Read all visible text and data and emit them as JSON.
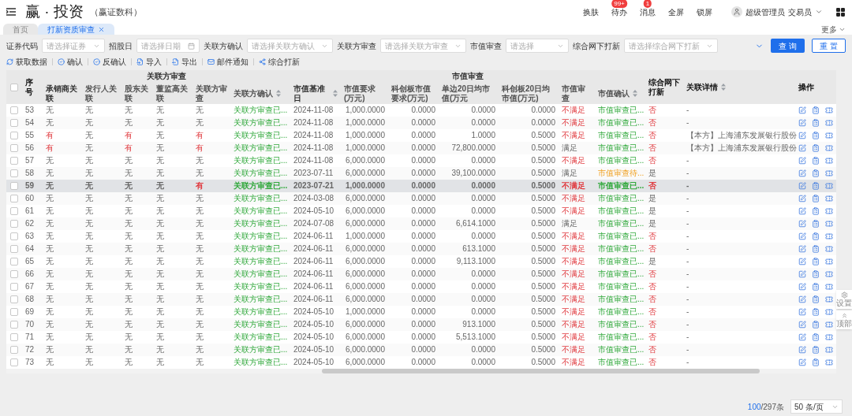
{
  "header": {
    "logo": "赢 · 投资",
    "subtitle": "（赢证数科）",
    "actions": [
      {
        "label": "换肤"
      },
      {
        "label": "待办",
        "badge": "99+"
      },
      {
        "label": "消息",
        "badge": "1"
      },
      {
        "label": "全屏"
      },
      {
        "label": "锁屏"
      }
    ],
    "user": "超级管理员",
    "role": "交易员"
  },
  "tabs": [
    {
      "label": "首页",
      "selected": false,
      "closable": false
    },
    {
      "label": "打新资质审查",
      "selected": true,
      "closable": true
    }
  ],
  "more": "更多",
  "filters": [
    {
      "label": "证券代码",
      "placeholder": "请选择证券",
      "kind": "select"
    },
    {
      "label": "招股日",
      "placeholder": "请选择日期",
      "kind": "date"
    },
    {
      "label": "关联方确认",
      "placeholder": "请选择关联方确认",
      "kind": "select"
    },
    {
      "label": "关联方审查",
      "placeholder": "请选择关联方审查",
      "kind": "select"
    },
    {
      "label": "市值审查",
      "placeholder": "请选择",
      "kind": "select"
    },
    {
      "label": "综合网下打新",
      "placeholder": "请选择综合网下打新",
      "kind": "select"
    }
  ],
  "filter_buttons": [
    {
      "label": "查 询",
      "kind": "primary"
    },
    {
      "label": "重 置",
      "kind": "outline"
    }
  ],
  "toolbar": [
    {
      "label": "获取数据"
    },
    {
      "label": "确认"
    },
    {
      "label": "反确认"
    },
    {
      "label": "导入"
    },
    {
      "label": "导出"
    },
    {
      "label": "邮件通知"
    },
    {
      "label": "综合打新"
    }
  ],
  "table": {
    "select_all": {
      "checked": false
    },
    "column_groups": [
      "关联方审查",
      "市值审查"
    ],
    "columns": [
      {
        "label": "序号",
        "grouped": false
      },
      {
        "label": "承销商关联",
        "grouped": true,
        "group_start": true
      },
      {
        "label": "发行人关联",
        "grouped": true
      },
      {
        "label": "股东关联",
        "grouped": true
      },
      {
        "label": "董监高关联",
        "grouped": true
      },
      {
        "label": "关联方审查",
        "grouped": true
      },
      {
        "label": "关联方确认",
        "grouped": true,
        "sortable": true
      },
      {
        "label": "市值基准日",
        "grouped": true,
        "group_start": true,
        "sortable": true
      },
      {
        "label": "市值要求(万元)",
        "grouped": true
      },
      {
        "label": "科创板市值要求(万元)",
        "grouped": true
      },
      {
        "label": "单边20日均市值(万元",
        "grouped": true
      },
      {
        "label": "科创板20日均市值(万元)",
        "grouped": true
      },
      {
        "label": "市值审查",
        "grouped": true
      },
      {
        "label": "市值确认",
        "grouped": true,
        "sortable": true
      },
      {
        "label": "综合网下打新",
        "grouped": false
      },
      {
        "label": "关联详情",
        "grouped": false,
        "sortable": true
      },
      {
        "label": "操作",
        "grouped": false,
        "kind": "actions"
      }
    ],
    "rows": [
      {
        "checked": false,
        "selected": false,
        "cells": [
          {
            "text": "53",
            "kind": "plain"
          },
          {
            "text": "无",
            "kind": "plain"
          },
          {
            "text": "无",
            "kind": "plain"
          },
          {
            "text": "无",
            "kind": "plain"
          },
          {
            "text": "无",
            "kind": "plain"
          },
          {
            "text": "无",
            "kind": "plain"
          },
          {
            "text": "关联方审查已...",
            "kind": "done"
          },
          {
            "text": "2024-11-08",
            "kind": "plain"
          },
          {
            "text": "1,000.0000",
            "kind": "plain"
          },
          {
            "text": "0.0000",
            "kind": "plain"
          },
          {
            "text": "0.0000",
            "kind": "plain"
          },
          {
            "text": "0.0000",
            "kind": "plain"
          },
          {
            "text": "不满足",
            "kind": "alert"
          },
          {
            "text": "市值审查已...",
            "kind": "done"
          },
          {
            "text": "否",
            "kind": "alert"
          },
          {
            "text": "-",
            "kind": "plain"
          }
        ]
      },
      {
        "checked": false,
        "selected": false,
        "cells": [
          {
            "text": "54",
            "kind": "plain"
          },
          {
            "text": "无",
            "kind": "plain"
          },
          {
            "text": "无",
            "kind": "plain"
          },
          {
            "text": "无",
            "kind": "plain"
          },
          {
            "text": "无",
            "kind": "plain"
          },
          {
            "text": "无",
            "kind": "plain"
          },
          {
            "text": "关联方审查已...",
            "kind": "done"
          },
          {
            "text": "2024-11-08",
            "kind": "plain"
          },
          {
            "text": "1,000.0000",
            "kind": "plain"
          },
          {
            "text": "0.0000",
            "kind": "plain"
          },
          {
            "text": "0.0000",
            "kind": "plain"
          },
          {
            "text": "0.0000",
            "kind": "plain"
          },
          {
            "text": "不满足",
            "kind": "alert"
          },
          {
            "text": "市值审查已...",
            "kind": "done"
          },
          {
            "text": "否",
            "kind": "alert"
          },
          {
            "text": "-",
            "kind": "plain"
          }
        ]
      },
      {
        "checked": false,
        "selected": false,
        "cells": [
          {
            "text": "55",
            "kind": "plain"
          },
          {
            "text": "有",
            "kind": "alert"
          },
          {
            "text": "无",
            "kind": "plain"
          },
          {
            "text": "有",
            "kind": "alert"
          },
          {
            "text": "无",
            "kind": "plain"
          },
          {
            "text": "有",
            "kind": "alert"
          },
          {
            "text": "关联方审查已...",
            "kind": "done"
          },
          {
            "text": "2024-11-08",
            "kind": "plain"
          },
          {
            "text": "1,000.0000",
            "kind": "plain"
          },
          {
            "text": "0.0000",
            "kind": "plain"
          },
          {
            "text": "1.0000",
            "kind": "plain"
          },
          {
            "text": "0.5000",
            "kind": "plain"
          },
          {
            "text": "不满足",
            "kind": "alert"
          },
          {
            "text": "市值审查已...",
            "kind": "done"
          },
          {
            "text": "否",
            "kind": "alert"
          },
          {
            "text": "【本方】上海浦东发展银行股份",
            "kind": "plain"
          }
        ]
      },
      {
        "checked": false,
        "selected": false,
        "cells": [
          {
            "text": "56",
            "kind": "plain"
          },
          {
            "text": "有",
            "kind": "alert"
          },
          {
            "text": "无",
            "kind": "plain"
          },
          {
            "text": "有",
            "kind": "alert"
          },
          {
            "text": "无",
            "kind": "plain"
          },
          {
            "text": "有",
            "kind": "alert"
          },
          {
            "text": "关联方审查已...",
            "kind": "done"
          },
          {
            "text": "2024-11-08",
            "kind": "plain"
          },
          {
            "text": "1,000.0000",
            "kind": "plain"
          },
          {
            "text": "0.0000",
            "kind": "plain"
          },
          {
            "text": "72,800.0000",
            "kind": "plain"
          },
          {
            "text": "0.5000",
            "kind": "plain"
          },
          {
            "text": "满足",
            "kind": "plain"
          },
          {
            "text": "市值审查已...",
            "kind": "done"
          },
          {
            "text": "否",
            "kind": "alert"
          },
          {
            "text": "【本方】上海浦东发展银行股份",
            "kind": "plain"
          }
        ]
      },
      {
        "checked": false,
        "selected": false,
        "cells": [
          {
            "text": "57",
            "kind": "plain"
          },
          {
            "text": "无",
            "kind": "plain"
          },
          {
            "text": "无",
            "kind": "plain"
          },
          {
            "text": "无",
            "kind": "plain"
          },
          {
            "text": "无",
            "kind": "plain"
          },
          {
            "text": "无",
            "kind": "plain"
          },
          {
            "text": "关联方审查已...",
            "kind": "done"
          },
          {
            "text": "2024-11-08",
            "kind": "plain"
          },
          {
            "text": "6,000.0000",
            "kind": "plain"
          },
          {
            "text": "0.0000",
            "kind": "plain"
          },
          {
            "text": "0.0000",
            "kind": "plain"
          },
          {
            "text": "0.5000",
            "kind": "plain"
          },
          {
            "text": "不满足",
            "kind": "alert"
          },
          {
            "text": "市值审查已...",
            "kind": "done"
          },
          {
            "text": "否",
            "kind": "alert"
          },
          {
            "text": "-",
            "kind": "plain"
          }
        ]
      },
      {
        "checked": false,
        "selected": false,
        "cells": [
          {
            "text": "58",
            "kind": "plain"
          },
          {
            "text": "无",
            "kind": "plain"
          },
          {
            "text": "无",
            "kind": "plain"
          },
          {
            "text": "无",
            "kind": "plain"
          },
          {
            "text": "无",
            "kind": "plain"
          },
          {
            "text": "无",
            "kind": "plain"
          },
          {
            "text": "关联方审查已...",
            "kind": "done"
          },
          {
            "text": "2023-07-11",
            "kind": "plain"
          },
          {
            "text": "6,000.0000",
            "kind": "plain"
          },
          {
            "text": "0.0000",
            "kind": "plain"
          },
          {
            "text": "39,100.0000",
            "kind": "plain"
          },
          {
            "text": "0.5000",
            "kind": "plain"
          },
          {
            "text": "满足",
            "kind": "plain"
          },
          {
            "text": "市值审查待...",
            "kind": "pending"
          },
          {
            "text": "是",
            "kind": "plain"
          },
          {
            "text": "-",
            "kind": "plain"
          }
        ]
      },
      {
        "checked": false,
        "selected": true,
        "cells": [
          {
            "text": "59",
            "kind": "plain"
          },
          {
            "text": "无",
            "kind": "plain"
          },
          {
            "text": "无",
            "kind": "plain"
          },
          {
            "text": "无",
            "kind": "plain"
          },
          {
            "text": "无",
            "kind": "plain"
          },
          {
            "text": "有",
            "kind": "alert"
          },
          {
            "text": "关联方审查已...",
            "kind": "done"
          },
          {
            "text": "2023-07-21",
            "kind": "plain"
          },
          {
            "text": "1,000.0000",
            "kind": "plain"
          },
          {
            "text": "0.0000",
            "kind": "plain"
          },
          {
            "text": "0.0000",
            "kind": "plain"
          },
          {
            "text": "0.5000",
            "kind": "plain"
          },
          {
            "text": "不满足",
            "kind": "alert"
          },
          {
            "text": "市值审查已...",
            "kind": "done"
          },
          {
            "text": "否",
            "kind": "alert"
          },
          {
            "text": "-",
            "kind": "plain"
          }
        ]
      },
      {
        "checked": false,
        "selected": false,
        "cells": [
          {
            "text": "60",
            "kind": "plain"
          },
          {
            "text": "无",
            "kind": "plain"
          },
          {
            "text": "无",
            "kind": "plain"
          },
          {
            "text": "无",
            "kind": "plain"
          },
          {
            "text": "无",
            "kind": "plain"
          },
          {
            "text": "无",
            "kind": "plain"
          },
          {
            "text": "关联方审查已...",
            "kind": "done"
          },
          {
            "text": "2024-03-08",
            "kind": "plain"
          },
          {
            "text": "6,000.0000",
            "kind": "plain"
          },
          {
            "text": "0.0000",
            "kind": "plain"
          },
          {
            "text": "0.0000",
            "kind": "plain"
          },
          {
            "text": "0.5000",
            "kind": "plain"
          },
          {
            "text": "不满足",
            "kind": "alert"
          },
          {
            "text": "市值审查已...",
            "kind": "done"
          },
          {
            "text": "是",
            "kind": "plain"
          },
          {
            "text": "-",
            "kind": "plain"
          }
        ]
      },
      {
        "checked": false,
        "selected": false,
        "cells": [
          {
            "text": "61",
            "kind": "plain"
          },
          {
            "text": "无",
            "kind": "plain"
          },
          {
            "text": "无",
            "kind": "plain"
          },
          {
            "text": "无",
            "kind": "plain"
          },
          {
            "text": "无",
            "kind": "plain"
          },
          {
            "text": "无",
            "kind": "plain"
          },
          {
            "text": "关联方审查已...",
            "kind": "done"
          },
          {
            "text": "2024-05-10",
            "kind": "plain"
          },
          {
            "text": "6,000.0000",
            "kind": "plain"
          },
          {
            "text": "0.0000",
            "kind": "plain"
          },
          {
            "text": "0.0000",
            "kind": "plain"
          },
          {
            "text": "0.5000",
            "kind": "plain"
          },
          {
            "text": "不满足",
            "kind": "alert"
          },
          {
            "text": "市值审查已...",
            "kind": "done"
          },
          {
            "text": "是",
            "kind": "plain"
          },
          {
            "text": "-",
            "kind": "plain"
          }
        ]
      },
      {
        "checked": false,
        "selected": false,
        "cells": [
          {
            "text": "62",
            "kind": "plain"
          },
          {
            "text": "无",
            "kind": "plain"
          },
          {
            "text": "无",
            "kind": "plain"
          },
          {
            "text": "无",
            "kind": "plain"
          },
          {
            "text": "无",
            "kind": "plain"
          },
          {
            "text": "无",
            "kind": "plain"
          },
          {
            "text": "关联方审查已...",
            "kind": "done"
          },
          {
            "text": "2024-07-08",
            "kind": "plain"
          },
          {
            "text": "6,000.0000",
            "kind": "plain"
          },
          {
            "text": "0.0000",
            "kind": "plain"
          },
          {
            "text": "6,614.1000",
            "kind": "plain"
          },
          {
            "text": "0.5000",
            "kind": "plain"
          },
          {
            "text": "满足",
            "kind": "plain"
          },
          {
            "text": "市值审查已...",
            "kind": "done"
          },
          {
            "text": "是",
            "kind": "plain"
          },
          {
            "text": "-",
            "kind": "plain"
          }
        ]
      },
      {
        "checked": false,
        "selected": false,
        "cells": [
          {
            "text": "63",
            "kind": "plain"
          },
          {
            "text": "无",
            "kind": "plain"
          },
          {
            "text": "无",
            "kind": "plain"
          },
          {
            "text": "无",
            "kind": "plain"
          },
          {
            "text": "无",
            "kind": "plain"
          },
          {
            "text": "无",
            "kind": "plain"
          },
          {
            "text": "关联方审查已...",
            "kind": "done"
          },
          {
            "text": "2024-06-11",
            "kind": "plain"
          },
          {
            "text": "1,000.0000",
            "kind": "plain"
          },
          {
            "text": "0.0000",
            "kind": "plain"
          },
          {
            "text": "0.0000",
            "kind": "plain"
          },
          {
            "text": "0.5000",
            "kind": "plain"
          },
          {
            "text": "不满足",
            "kind": "alert"
          },
          {
            "text": "市值审查已...",
            "kind": "done"
          },
          {
            "text": "否",
            "kind": "alert"
          },
          {
            "text": "-",
            "kind": "plain"
          }
        ]
      },
      {
        "checked": false,
        "selected": false,
        "cells": [
          {
            "text": "64",
            "kind": "plain"
          },
          {
            "text": "无",
            "kind": "plain"
          },
          {
            "text": "无",
            "kind": "plain"
          },
          {
            "text": "无",
            "kind": "plain"
          },
          {
            "text": "无",
            "kind": "plain"
          },
          {
            "text": "无",
            "kind": "plain"
          },
          {
            "text": "关联方审查已...",
            "kind": "done"
          },
          {
            "text": "2024-06-11",
            "kind": "plain"
          },
          {
            "text": "6,000.0000",
            "kind": "plain"
          },
          {
            "text": "0.0000",
            "kind": "plain"
          },
          {
            "text": "613.1000",
            "kind": "plain"
          },
          {
            "text": "0.5000",
            "kind": "plain"
          },
          {
            "text": "不满足",
            "kind": "alert"
          },
          {
            "text": "市值审查已...",
            "kind": "done"
          },
          {
            "text": "否",
            "kind": "alert"
          },
          {
            "text": "-",
            "kind": "plain"
          }
        ]
      },
      {
        "checked": false,
        "selected": false,
        "cells": [
          {
            "text": "65",
            "kind": "plain"
          },
          {
            "text": "无",
            "kind": "plain"
          },
          {
            "text": "无",
            "kind": "plain"
          },
          {
            "text": "无",
            "kind": "plain"
          },
          {
            "text": "无",
            "kind": "plain"
          },
          {
            "text": "无",
            "kind": "plain"
          },
          {
            "text": "关联方审查已...",
            "kind": "done"
          },
          {
            "text": "2024-06-11",
            "kind": "plain"
          },
          {
            "text": "6,000.0000",
            "kind": "plain"
          },
          {
            "text": "0.0000",
            "kind": "plain"
          },
          {
            "text": "9,113.1000",
            "kind": "plain"
          },
          {
            "text": "0.5000",
            "kind": "plain"
          },
          {
            "text": "不满足",
            "kind": "alert"
          },
          {
            "text": "市值审查已...",
            "kind": "done"
          },
          {
            "text": "是",
            "kind": "plain"
          },
          {
            "text": "-",
            "kind": "plain"
          }
        ]
      },
      {
        "checked": false,
        "selected": false,
        "cells": [
          {
            "text": "66",
            "kind": "plain"
          },
          {
            "text": "无",
            "kind": "plain"
          },
          {
            "text": "无",
            "kind": "plain"
          },
          {
            "text": "无",
            "kind": "plain"
          },
          {
            "text": "无",
            "kind": "plain"
          },
          {
            "text": "无",
            "kind": "plain"
          },
          {
            "text": "关联方审查已...",
            "kind": "done"
          },
          {
            "text": "2024-06-11",
            "kind": "plain"
          },
          {
            "text": "6,000.0000",
            "kind": "plain"
          },
          {
            "text": "0.0000",
            "kind": "plain"
          },
          {
            "text": "0.0000",
            "kind": "plain"
          },
          {
            "text": "0.5000",
            "kind": "plain"
          },
          {
            "text": "不满足",
            "kind": "alert"
          },
          {
            "text": "市值审查已...",
            "kind": "done"
          },
          {
            "text": "否",
            "kind": "alert"
          },
          {
            "text": "-",
            "kind": "plain"
          }
        ]
      },
      {
        "checked": false,
        "selected": false,
        "cells": [
          {
            "text": "67",
            "kind": "plain"
          },
          {
            "text": "无",
            "kind": "plain"
          },
          {
            "text": "无",
            "kind": "plain"
          },
          {
            "text": "无",
            "kind": "plain"
          },
          {
            "text": "无",
            "kind": "plain"
          },
          {
            "text": "无",
            "kind": "plain"
          },
          {
            "text": "关联方审查已...",
            "kind": "done"
          },
          {
            "text": "2024-06-11",
            "kind": "plain"
          },
          {
            "text": "6,000.0000",
            "kind": "plain"
          },
          {
            "text": "0.0000",
            "kind": "plain"
          },
          {
            "text": "0.0000",
            "kind": "plain"
          },
          {
            "text": "0.5000",
            "kind": "plain"
          },
          {
            "text": "不满足",
            "kind": "alert"
          },
          {
            "text": "市值审查已...",
            "kind": "done"
          },
          {
            "text": "否",
            "kind": "alert"
          },
          {
            "text": "-",
            "kind": "plain"
          }
        ]
      },
      {
        "checked": false,
        "selected": false,
        "cells": [
          {
            "text": "68",
            "kind": "plain"
          },
          {
            "text": "无",
            "kind": "plain"
          },
          {
            "text": "无",
            "kind": "plain"
          },
          {
            "text": "无",
            "kind": "plain"
          },
          {
            "text": "无",
            "kind": "plain"
          },
          {
            "text": "无",
            "kind": "plain"
          },
          {
            "text": "关联方审查已...",
            "kind": "done"
          },
          {
            "text": "2024-06-11",
            "kind": "plain"
          },
          {
            "text": "6,000.0000",
            "kind": "plain"
          },
          {
            "text": "0.0000",
            "kind": "plain"
          },
          {
            "text": "0.0000",
            "kind": "plain"
          },
          {
            "text": "0.5000",
            "kind": "plain"
          },
          {
            "text": "不满足",
            "kind": "alert"
          },
          {
            "text": "市值审查已...",
            "kind": "done"
          },
          {
            "text": "否",
            "kind": "alert"
          },
          {
            "text": "-",
            "kind": "plain"
          }
        ]
      },
      {
        "checked": false,
        "selected": false,
        "cells": [
          {
            "text": "69",
            "kind": "plain"
          },
          {
            "text": "无",
            "kind": "plain"
          },
          {
            "text": "无",
            "kind": "plain"
          },
          {
            "text": "无",
            "kind": "plain"
          },
          {
            "text": "无",
            "kind": "plain"
          },
          {
            "text": "无",
            "kind": "plain"
          },
          {
            "text": "关联方审查已...",
            "kind": "done"
          },
          {
            "text": "2024-05-10",
            "kind": "plain"
          },
          {
            "text": "1,000.0000",
            "kind": "plain"
          },
          {
            "text": "0.0000",
            "kind": "plain"
          },
          {
            "text": "0.0000",
            "kind": "plain"
          },
          {
            "text": "0.5000",
            "kind": "plain"
          },
          {
            "text": "不满足",
            "kind": "alert"
          },
          {
            "text": "市值审查已...",
            "kind": "done"
          },
          {
            "text": "否",
            "kind": "alert"
          },
          {
            "text": "-",
            "kind": "plain"
          }
        ]
      },
      {
        "checked": false,
        "selected": false,
        "cells": [
          {
            "text": "70",
            "kind": "plain"
          },
          {
            "text": "无",
            "kind": "plain"
          },
          {
            "text": "无",
            "kind": "plain"
          },
          {
            "text": "无",
            "kind": "plain"
          },
          {
            "text": "无",
            "kind": "plain"
          },
          {
            "text": "无",
            "kind": "plain"
          },
          {
            "text": "关联方审查已...",
            "kind": "done"
          },
          {
            "text": "2024-05-10",
            "kind": "plain"
          },
          {
            "text": "6,000.0000",
            "kind": "plain"
          },
          {
            "text": "0.0000",
            "kind": "plain"
          },
          {
            "text": "913.1000",
            "kind": "plain"
          },
          {
            "text": "0.5000",
            "kind": "plain"
          },
          {
            "text": "不满足",
            "kind": "alert"
          },
          {
            "text": "市值审查已...",
            "kind": "done"
          },
          {
            "text": "否",
            "kind": "alert"
          },
          {
            "text": "-",
            "kind": "plain"
          }
        ]
      },
      {
        "checked": false,
        "selected": false,
        "cells": [
          {
            "text": "71",
            "kind": "plain"
          },
          {
            "text": "无",
            "kind": "plain"
          },
          {
            "text": "无",
            "kind": "plain"
          },
          {
            "text": "无",
            "kind": "plain"
          },
          {
            "text": "无",
            "kind": "plain"
          },
          {
            "text": "无",
            "kind": "plain"
          },
          {
            "text": "关联方审查已...",
            "kind": "done"
          },
          {
            "text": "2024-05-10",
            "kind": "plain"
          },
          {
            "text": "6,000.0000",
            "kind": "plain"
          },
          {
            "text": "0.0000",
            "kind": "plain"
          },
          {
            "text": "5,513.1000",
            "kind": "plain"
          },
          {
            "text": "0.5000",
            "kind": "plain"
          },
          {
            "text": "不满足",
            "kind": "alert"
          },
          {
            "text": "市值审查已...",
            "kind": "done"
          },
          {
            "text": "否",
            "kind": "alert"
          },
          {
            "text": "-",
            "kind": "plain"
          }
        ]
      },
      {
        "checked": false,
        "selected": false,
        "cells": [
          {
            "text": "72",
            "kind": "plain"
          },
          {
            "text": "无",
            "kind": "plain"
          },
          {
            "text": "无",
            "kind": "plain"
          },
          {
            "text": "无",
            "kind": "plain"
          },
          {
            "text": "无",
            "kind": "plain"
          },
          {
            "text": "无",
            "kind": "plain"
          },
          {
            "text": "关联方审查已...",
            "kind": "done"
          },
          {
            "text": "2024-05-10",
            "kind": "plain"
          },
          {
            "text": "6,000.0000",
            "kind": "plain"
          },
          {
            "text": "0.0000",
            "kind": "plain"
          },
          {
            "text": "0.0000",
            "kind": "plain"
          },
          {
            "text": "0.5000",
            "kind": "plain"
          },
          {
            "text": "不满足",
            "kind": "alert"
          },
          {
            "text": "市值审查已...",
            "kind": "done"
          },
          {
            "text": "否",
            "kind": "alert"
          },
          {
            "text": "-",
            "kind": "plain"
          }
        ]
      },
      {
        "checked": false,
        "selected": false,
        "cells": [
          {
            "text": "73",
            "kind": "plain"
          },
          {
            "text": "无",
            "kind": "plain"
          },
          {
            "text": "无",
            "kind": "plain"
          },
          {
            "text": "无",
            "kind": "plain"
          },
          {
            "text": "无",
            "kind": "plain"
          },
          {
            "text": "无",
            "kind": "plain"
          },
          {
            "text": "关联方审查已...",
            "kind": "done"
          },
          {
            "text": "2024-05-10",
            "kind": "plain"
          },
          {
            "text": "6,000.0000",
            "kind": "plain"
          },
          {
            "text": "0.0000",
            "kind": "plain"
          },
          {
            "text": "0.0000",
            "kind": "plain"
          },
          {
            "text": "0.5000",
            "kind": "plain"
          },
          {
            "text": "不满足",
            "kind": "alert"
          },
          {
            "text": "市值审查已...",
            "kind": "done"
          },
          {
            "text": "否",
            "kind": "alert"
          },
          {
            "text": "-",
            "kind": "plain"
          }
        ]
      }
    ]
  },
  "pagination": {
    "shown": "100",
    "total": "/297条",
    "page_size": "50 条/页"
  },
  "side_buttons": [
    {
      "label": "设置"
    },
    {
      "label": "顶部"
    }
  ]
}
